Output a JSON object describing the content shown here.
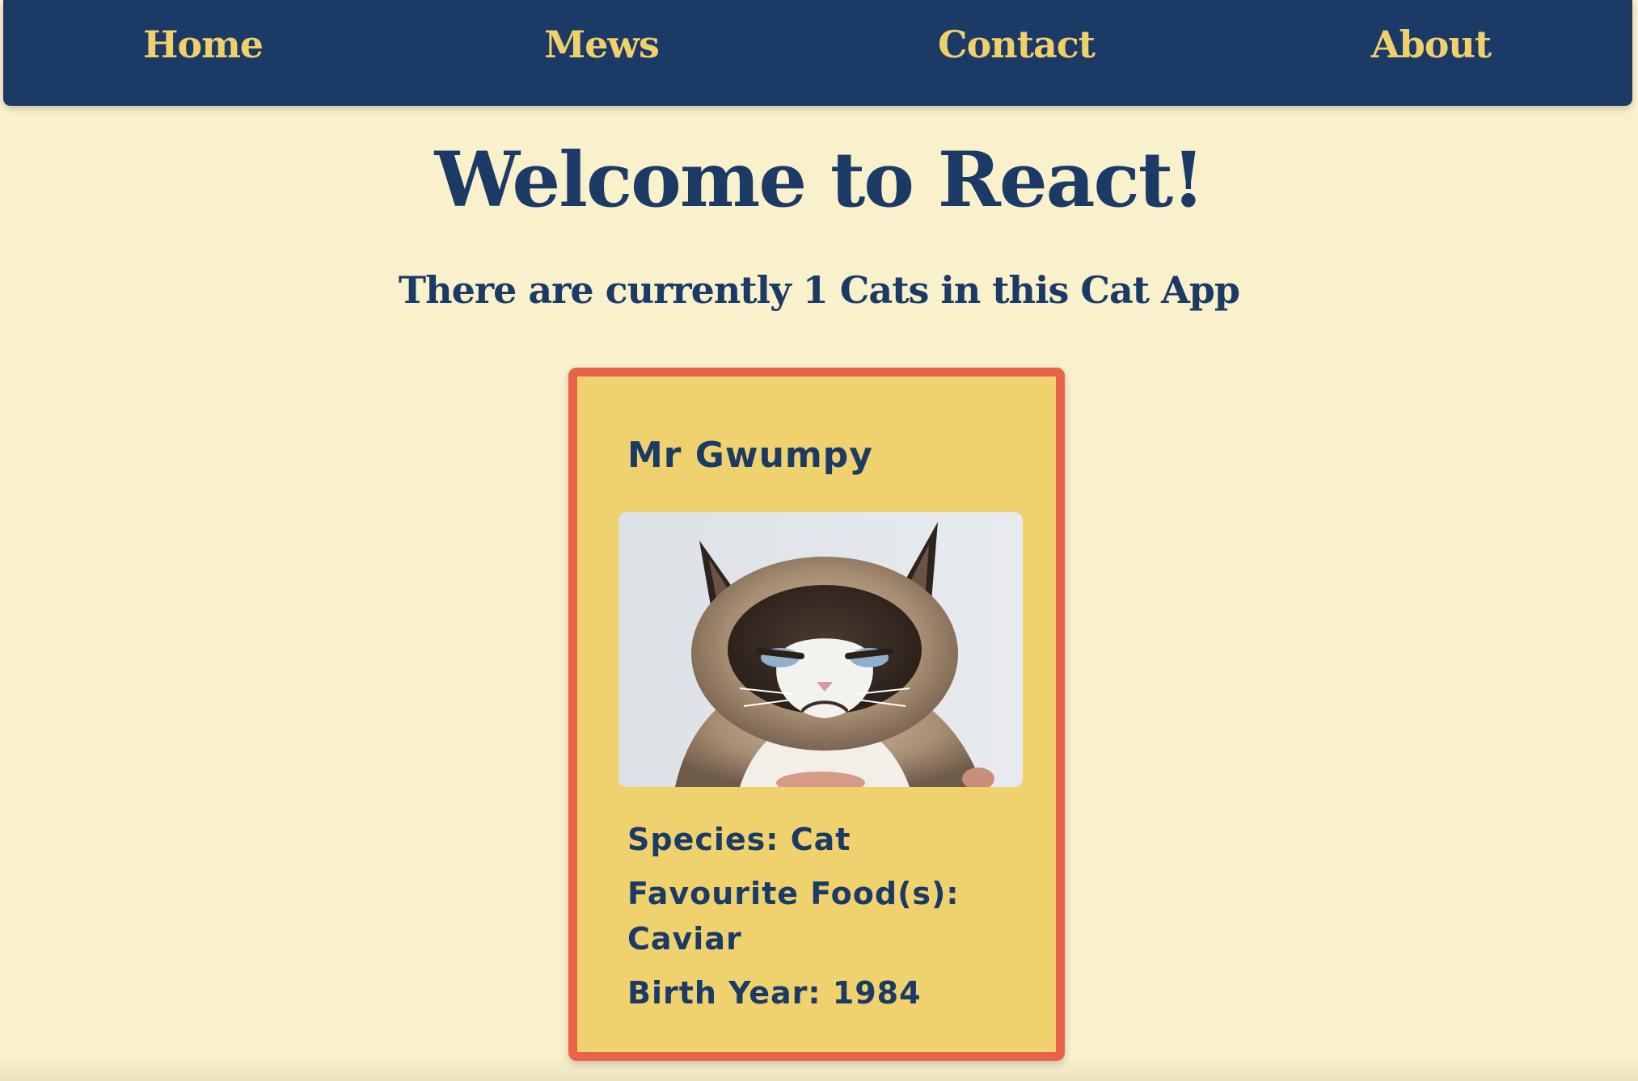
{
  "nav": {
    "items": [
      {
        "label": "Home"
      },
      {
        "label": "Mews"
      },
      {
        "label": "Contact"
      },
      {
        "label": "About"
      }
    ]
  },
  "main": {
    "title": "Welcome to React!",
    "subtitle": "There are currently 1 Cats in this Cat App"
  },
  "cats": [
    {
      "name": "Mr Gwumpy",
      "species": "Species: Cat",
      "food": "Favourite Food(s): Caviar",
      "birth_year": "Birth Year: 1984",
      "photo": "grumpy-cat-photo"
    }
  ],
  "colors": {
    "background": "#f9f0cc",
    "navbar": "#1c3a66",
    "nav_text": "#f0d06a",
    "card": "#efd26e",
    "card_border": "#e8634a",
    "text": "#1c3a66"
  }
}
